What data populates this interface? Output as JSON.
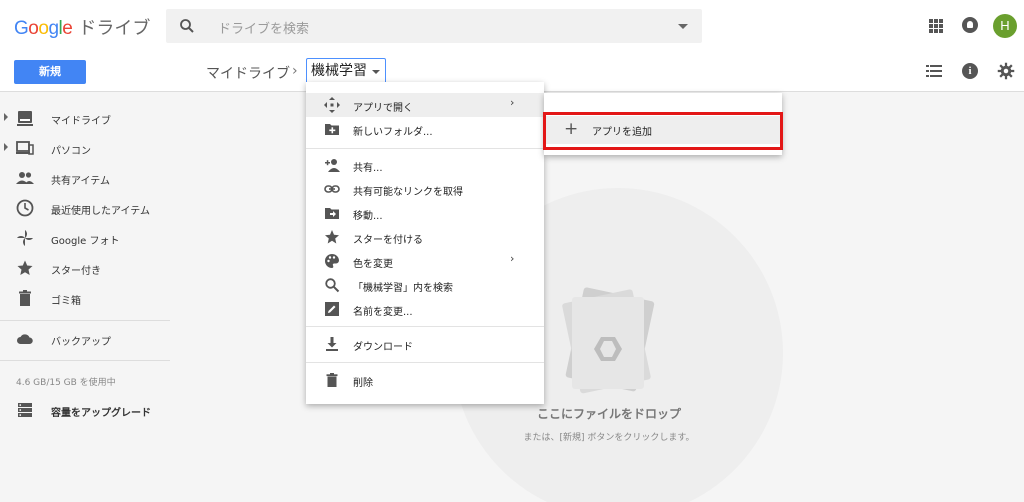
{
  "header": {
    "logo_google": "Google",
    "logo_app": "ドライブ",
    "search_placeholder": "ドライブを検索",
    "avatar_initial": "H"
  },
  "toolbar": {
    "new_label": "新規",
    "breadcrumb_root": "マイドライブ",
    "breadcrumb_sep": "›",
    "breadcrumb_current": "機械学習",
    "info_glyph": "i"
  },
  "sidebar": {
    "items": [
      {
        "label": "マイドライブ",
        "icon": "my-drive-icon"
      },
      {
        "label": "パソコン",
        "icon": "computer-icon"
      },
      {
        "label": "共有アイテム",
        "icon": "people-icon"
      },
      {
        "label": "最近使用したアイテム",
        "icon": "clock-icon"
      },
      {
        "label": "Google フォト",
        "icon": "pinwheel-icon"
      },
      {
        "label": "スター付き",
        "icon": "star-icon"
      },
      {
        "label": "ゴミ箱",
        "icon": "trash-icon"
      },
      {
        "label": "バックアップ",
        "icon": "cloud-icon"
      },
      {
        "label": "容量をアップグレード",
        "icon": "storage-icon"
      }
    ],
    "storage_text": "4.6 GB/15 GB を使用中"
  },
  "context_menu": {
    "items": [
      {
        "label": "アプリで開く",
        "icon": "move-arrows-icon",
        "has_submenu": true,
        "highlighted": true
      },
      {
        "label": "新しいフォルダ...",
        "icon": "add-folder-icon"
      },
      {
        "label": "共有...",
        "icon": "add-person-icon"
      },
      {
        "label": "共有可能なリンクを取得",
        "icon": "link-icon"
      },
      {
        "label": "移動...",
        "icon": "move-folder-icon"
      },
      {
        "label": "スターを付ける",
        "icon": "star-icon"
      },
      {
        "label": "色を変更",
        "icon": "palette-icon",
        "has_submenu": true
      },
      {
        "label": "「機械学習」内を検索",
        "icon": "search-icon"
      },
      {
        "label": "名前を変更...",
        "icon": "edit-icon"
      },
      {
        "label": "ダウンロード",
        "icon": "download-icon"
      },
      {
        "label": "削除",
        "icon": "trash-icon"
      }
    ],
    "arrow": "›"
  },
  "submenu": {
    "add_app_label": "アプリを追加",
    "plus_glyph": "+"
  },
  "empty_state": {
    "title": "ここにファイルをドロップ",
    "subtitle": "または、[新規] ボタンをクリックします。"
  },
  "colors": {
    "accent": "#4285f4",
    "highlight_border": "#e31717",
    "avatar_bg": "#6a9f2e"
  }
}
